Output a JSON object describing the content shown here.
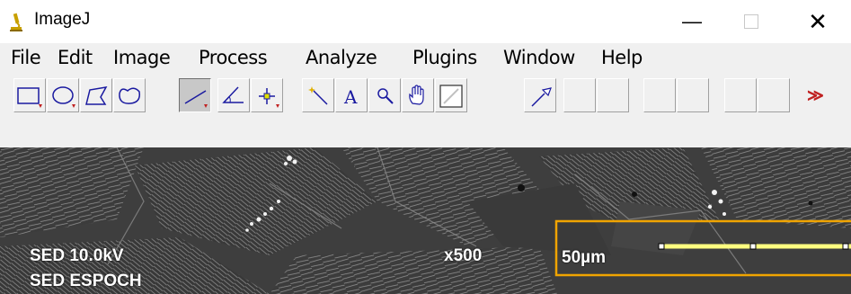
{
  "window": {
    "title": "ImageJ",
    "icon": "microscope-icon",
    "controls": {
      "minimize": "—",
      "maximize": "",
      "close": "✕"
    }
  },
  "menu": [
    "File",
    "Edit",
    "Image",
    "Process",
    "Analyze",
    "Plugins",
    "Window",
    "Help"
  ],
  "toolbar": {
    "tools": [
      {
        "name": "rectangle-tool-icon",
        "selected": false
      },
      {
        "name": "oval-tool-icon",
        "selected": false
      },
      {
        "name": "polygon-tool-icon",
        "selected": false
      },
      {
        "name": "freehand-tool-icon",
        "selected": false
      },
      {
        "name": "straight-line-tool-icon",
        "selected": true
      },
      {
        "name": "angle-tool-icon",
        "selected": false
      },
      {
        "name": "point-tool-icon",
        "selected": false
      },
      {
        "name": "wand-tool-icon",
        "selected": false
      },
      {
        "name": "text-tool-icon",
        "selected": false
      },
      {
        "name": "magnifier-tool-icon",
        "selected": false
      },
      {
        "name": "hand-tool-icon",
        "selected": false
      },
      {
        "name": "color-picker-tool-icon",
        "selected": false
      },
      {
        "name": "pipette-tool-icon",
        "selected": false
      }
    ],
    "text_tool_label": "A",
    "more_label": "≫"
  },
  "image": {
    "labels": {
      "detector_voltage": "SED 10.0kV",
      "detector_lab": "SED ESPOCH",
      "magnification": "x500",
      "scale": "50µm"
    },
    "highlight_color": "#f0a400",
    "line_color": "#ffff80"
  }
}
